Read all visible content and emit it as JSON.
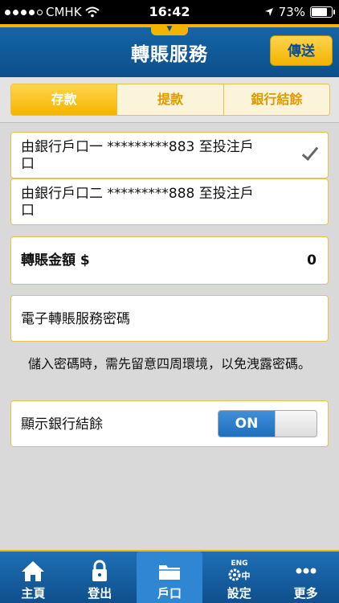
{
  "status_bar": {
    "carrier": "CMHK",
    "time": "16:42",
    "battery": "73%"
  },
  "header": {
    "title": "轉賬服務",
    "send_label": "傳送"
  },
  "tabs": [
    {
      "label": "存款",
      "active": true
    },
    {
      "label": "提款",
      "active": false
    },
    {
      "label": "銀行結餘",
      "active": false
    }
  ],
  "accounts": [
    {
      "text": "由銀行戶口一 *********883 至投注戶口",
      "selected": true
    },
    {
      "text": "由銀行戶口二 *********888 至投注戶口",
      "selected": false
    }
  ],
  "amount": {
    "label": "轉賬金額 $",
    "value": "0"
  },
  "password": {
    "label": "電子轉賬服務密碼"
  },
  "notice": "儲入密碼時，需先留意四周環境，以免洩露密碼。",
  "show_balance": {
    "label": "顯示銀行結餘",
    "toggle_label": "ON",
    "on": true
  },
  "bottom_nav": [
    {
      "label": "主頁",
      "icon": "home-icon",
      "active": false
    },
    {
      "label": "登出",
      "icon": "lock-icon",
      "active": false
    },
    {
      "label": "戶口",
      "icon": "folder-icon",
      "active": true
    },
    {
      "label": "設定",
      "icon": "settings-gear-icon",
      "icon_text": "ENG 中",
      "active": false
    },
    {
      "label": "更多",
      "icon": "more-icon",
      "active": false
    }
  ],
  "colors": {
    "accent": "#f2b400",
    "header_blue": "#0c4f8a",
    "toggle_on": "#1f6fbf"
  }
}
